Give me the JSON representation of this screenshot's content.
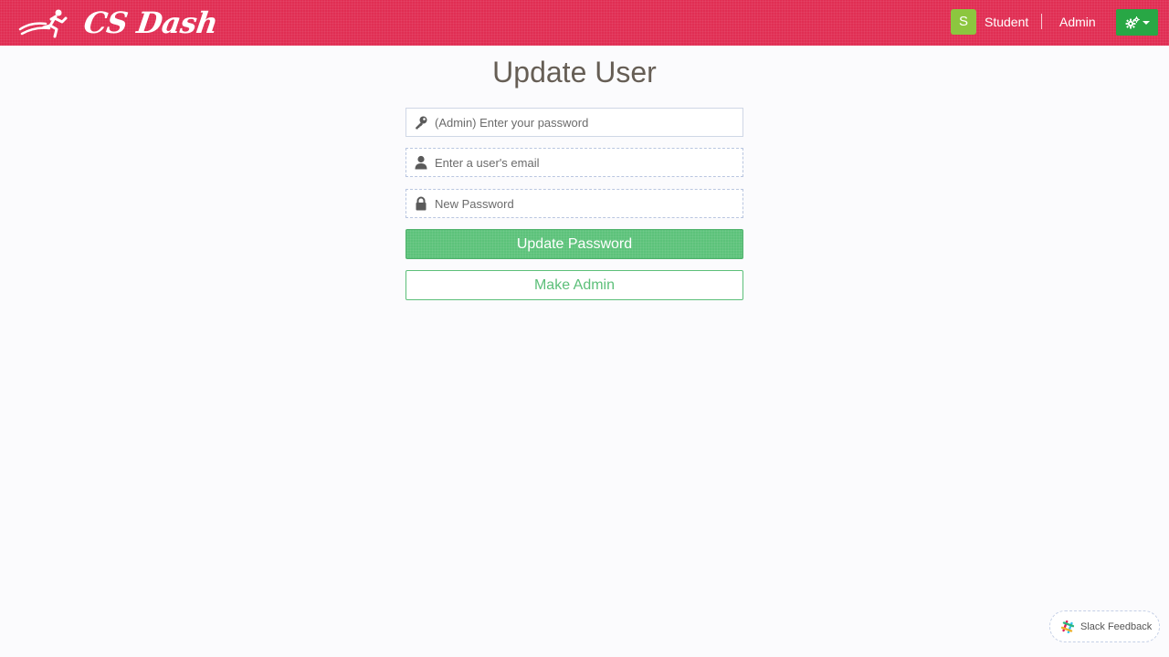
{
  "navbar": {
    "brand": "CS Dash",
    "avatar_letter": "S",
    "student_link": "Student",
    "admin_link": "Admin",
    "settings_icon": "cogs-icon"
  },
  "main": {
    "title": "Update User",
    "fields": [
      {
        "icon": "key-icon",
        "placeholder": "(Admin) Enter your password",
        "value": ""
      },
      {
        "icon": "user-icon",
        "placeholder": "Enter a user's email",
        "value": ""
      },
      {
        "icon": "lock-icon",
        "placeholder": "New Password",
        "value": ""
      }
    ],
    "update_button": "Update Password",
    "make_admin_button": "Make Admin"
  },
  "slack": {
    "label": "Slack Feedback",
    "icon": "slack-icon"
  },
  "colors": {
    "navbar": "#e02e53",
    "avatar": "#8cc63f",
    "settings_button": "#28a745",
    "primary_button": "#5cc27a",
    "title_text": "#665e55"
  }
}
